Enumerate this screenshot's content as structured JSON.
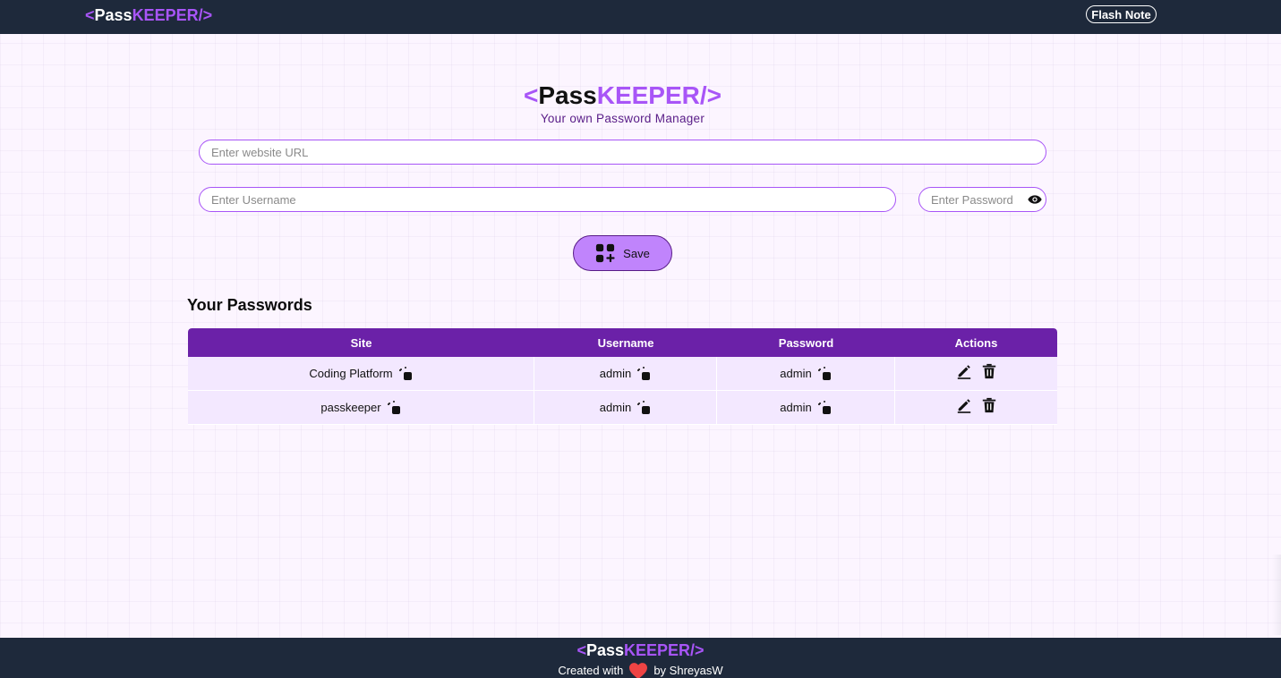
{
  "navbar": {
    "logo_lt": "<",
    "logo_pass": "Pass",
    "logo_keeper": "KEEPER",
    "logo_gt": "/>",
    "flash_note_label": "Flash Note"
  },
  "hero": {
    "logo_lt": "<",
    "logo_pass": "Pass",
    "logo_keeper": "KEEPER",
    "logo_gt": "/>",
    "subtitle": "Your own Password Manager"
  },
  "form": {
    "url_placeholder": "Enter website URL",
    "username_placeholder": "Enter Username",
    "password_placeholder": "Enter Password",
    "save_label": "Save"
  },
  "passwords": {
    "title": "Your Passwords",
    "columns": [
      "Site",
      "Username",
      "Password",
      "Actions"
    ],
    "rows": [
      {
        "site": "Coding Platform",
        "username": "admin",
        "password": "admin"
      },
      {
        "site": "passkeeper",
        "username": "admin",
        "password": "admin"
      }
    ]
  },
  "footer": {
    "logo_lt": "<",
    "logo_pass": "Pass",
    "logo_keeper": "KEEPER",
    "logo_gt": "/>",
    "created_with": "Created with",
    "by": "by ShreyasW"
  },
  "colors": {
    "navbar_bg": "#1e293b",
    "accent_purple": "#a855f7",
    "table_header": "#6b21a8",
    "table_row": "#f3e8ff",
    "save_button": "#c084fc",
    "heart": "#ef4444"
  }
}
